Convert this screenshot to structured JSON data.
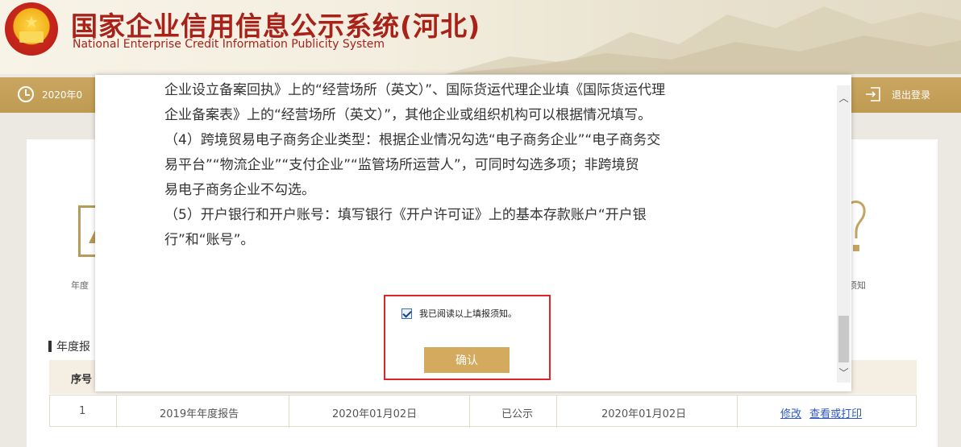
{
  "header": {
    "title": "国家企业信用信息公示系统(河北)",
    "subtitle": "National Enterprise Credit Information Publicity System"
  },
  "infobar": {
    "date_partial": "2020年0",
    "logout_label": "退出登录"
  },
  "nav": {
    "left_label_partial": "年度",
    "right_label_partial": "须知"
  },
  "section": {
    "title_partial": "年度报"
  },
  "table": {
    "header_seq": "序号",
    "rows": [
      {
        "seq": "1",
        "name": "2019年年度报告",
        "submit_date": "2020年01月02日",
        "status": "已公示",
        "publish_date": "2020年01月02日",
        "action_edit": "修改",
        "action_view": "查看或打印"
      }
    ]
  },
  "modal": {
    "lines": [
      "企业设立备案回执》上的“经营场所（英文）”、国际货运代理企业填《国际货运代理",
      "企业备案表》上的“经营场所（英文）”，其他企业或组织机构可以根据情况填写。",
      "（4）跨境贸易电子商务企业类型：根据企业情况勾选“电子商务企业”“电子商务交",
      "易平台”“物流企业”“支付企业”“监管场所运营人”，可同时勾选多项；非跨境贸",
      "易电子商务企业不勾选。",
      "（5）开户银行和开户账号：填写银行《开户许可证》上的基本存款账户“开户银",
      "行”和“账号”。"
    ],
    "agree_label": "我已阅读以上填报须知。",
    "agree_checked": true,
    "confirm_label": "确认"
  },
  "colors": {
    "brand_red": "#a8221a",
    "gold_bar": "#c9a660",
    "confirm_button": "#d3aa5e",
    "highlight": "#e0242a",
    "link_blue": "#2c57c6"
  }
}
